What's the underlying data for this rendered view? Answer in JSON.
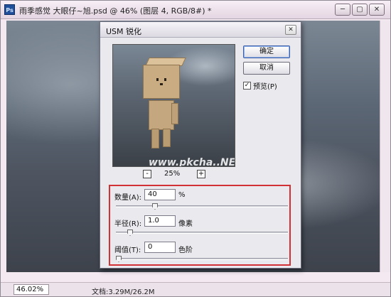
{
  "document": {
    "title": "雨季感觉 大眼仔~旭.psd @ 46% (图层 4, RGB/8#) *",
    "zoom": "46.02%",
    "doc_info": "文档:3.29M/26.2M",
    "app_icon": "Ps",
    "window_buttons": {
      "minimize": "─",
      "restore": "▢",
      "close": "✕"
    }
  },
  "dialog": {
    "title": "USM 锐化",
    "close_glyph": "✕",
    "ok_label": "确定",
    "cancel_label": "取消",
    "preview_label": "预览(P)",
    "preview_checked": true,
    "preview_zoom": "25%",
    "zoom_minus": "-",
    "zoom_plus": "+",
    "watermark": "www.pkcha..NET",
    "amount": {
      "label": "数量(A):",
      "value": "40",
      "unit": "%",
      "slider_fraction": 0.22
    },
    "radius": {
      "label": "半径(R):",
      "value": "1.0",
      "unit": "像素",
      "slider_fraction": 0.07
    },
    "threshold": {
      "label": "阈值(T):",
      "value": "0",
      "unit": "色阶",
      "slider_fraction": 0.0
    },
    "highlight_color": "#d23236"
  },
  "icons": {
    "app": "photoshop-icon",
    "check": "✓"
  }
}
